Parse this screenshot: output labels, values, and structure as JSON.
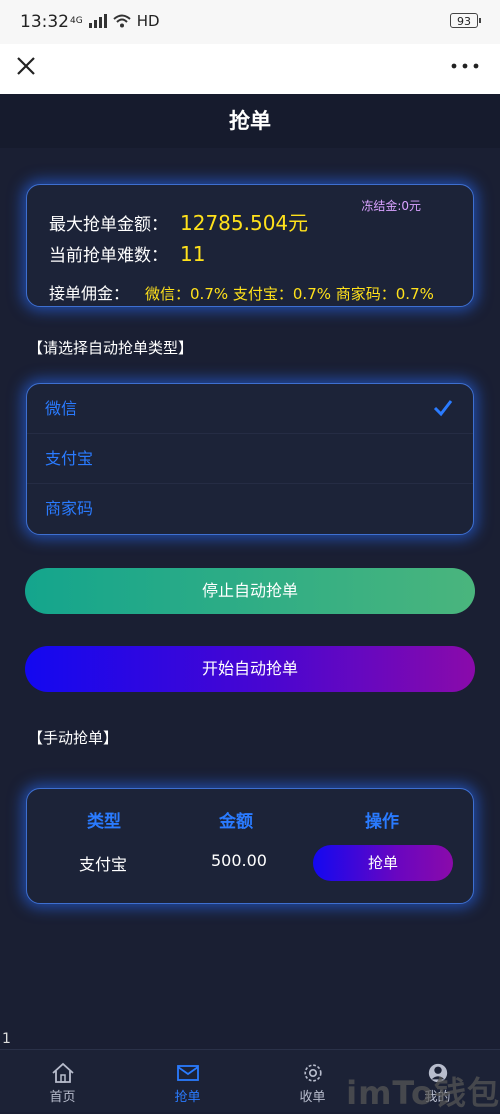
{
  "status_bar": {
    "time": "13:32",
    "network": "4G",
    "hd": "HD",
    "battery": "93"
  },
  "header": {
    "title": "抢单"
  },
  "info": {
    "max_label": "最大抢单金额：",
    "max_value": "12785.504元",
    "difficulty_label": "当前抢单难数：",
    "difficulty_value": "11",
    "frozen": "冻结金:0元",
    "commission_label": "接单佣金：",
    "commission_value": "微信：0.7% 支付宝：0.7% 商家码：0.7%"
  },
  "select_label": "【请选择自动抢单类型】",
  "types": [
    {
      "label": "微信",
      "selected": true
    },
    {
      "label": "支付宝",
      "selected": false
    },
    {
      "label": "商家码",
      "selected": false
    }
  ],
  "buttons": {
    "stop": "停止自动抢单",
    "start": "开始自动抢单"
  },
  "manual_label": "【手动抢单】",
  "manual_table": {
    "headers": [
      "类型",
      "金额",
      "操作"
    ],
    "row": {
      "type": "支付宝",
      "amount": "500.00",
      "action": "抢单"
    }
  },
  "stray_text": "1",
  "tabs": [
    {
      "label": "首页",
      "icon": "home-icon",
      "active": false
    },
    {
      "label": "抢单",
      "icon": "mail-icon",
      "active": true
    },
    {
      "label": "收单",
      "icon": "gear-icon",
      "active": false
    },
    {
      "label": "我的",
      "icon": "user-icon",
      "active": false
    }
  ],
  "watermark": "imTo钱包",
  "colors": {
    "accent": "#2a7bff",
    "highlight": "#ffe11b",
    "frozen": "#d9a2ff",
    "background": "#1a1f33"
  }
}
